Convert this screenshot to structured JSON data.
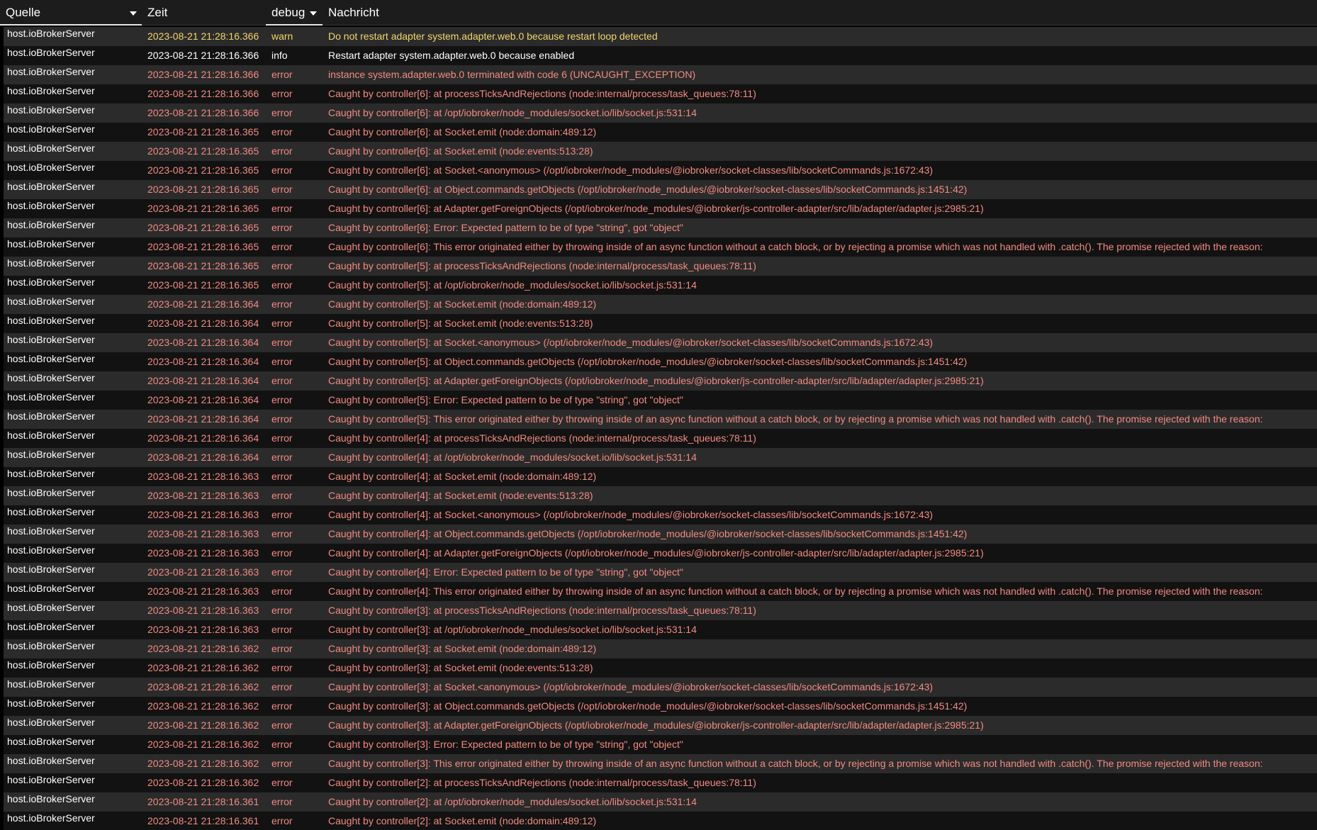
{
  "columns": {
    "source": "Quelle",
    "time": "Zeit",
    "severity": "debug",
    "message": "Nachricht"
  },
  "colors": {
    "error": "#f28b82",
    "warn": "#f3d56b",
    "info": "#ffffff"
  },
  "icons": {
    "source_filter": "chevron-down-icon",
    "severity_filter": "chevron-down-icon"
  },
  "rows": [
    {
      "source": "host.ioBrokerServer",
      "time": "2023-08-21 21:28:16.366",
      "severity": "warn",
      "message": "Do not restart adapter system.adapter.web.0 because restart loop detected"
    },
    {
      "source": "host.ioBrokerServer",
      "time": "2023-08-21 21:28:16.366",
      "severity": "info",
      "message": "Restart adapter system.adapter.web.0 because enabled"
    },
    {
      "source": "host.ioBrokerServer",
      "time": "2023-08-21 21:28:16.366",
      "severity": "error",
      "message": "instance system.adapter.web.0 terminated with code 6 (UNCAUGHT_EXCEPTION)"
    },
    {
      "source": "host.ioBrokerServer",
      "time": "2023-08-21 21:28:16.366",
      "severity": "error",
      "message": "Caught by controller[6]: at processTicksAndRejections (node:internal/process/task_queues:78:11)"
    },
    {
      "source": "host.ioBrokerServer",
      "time": "2023-08-21 21:28:16.366",
      "severity": "error",
      "message": "Caught by controller[6]: at /opt/iobroker/node_modules/socket.io/lib/socket.js:531:14"
    },
    {
      "source": "host.ioBrokerServer",
      "time": "2023-08-21 21:28:16.365",
      "severity": "error",
      "message": "Caught by controller[6]: at Socket.emit (node:domain:489:12)"
    },
    {
      "source": "host.ioBrokerServer",
      "time": "2023-08-21 21:28:16.365",
      "severity": "error",
      "message": "Caught by controller[6]: at Socket.emit (node:events:513:28)"
    },
    {
      "source": "host.ioBrokerServer",
      "time": "2023-08-21 21:28:16.365",
      "severity": "error",
      "message": "Caught by controller[6]: at Socket.<anonymous> (/opt/iobroker/node_modules/@iobroker/socket-classes/lib/socketCommands.js:1672:43)"
    },
    {
      "source": "host.ioBrokerServer",
      "time": "2023-08-21 21:28:16.365",
      "severity": "error",
      "message": "Caught by controller[6]: at Object.commands.getObjects (/opt/iobroker/node_modules/@iobroker/socket-classes/lib/socketCommands.js:1451:42)"
    },
    {
      "source": "host.ioBrokerServer",
      "time": "2023-08-21 21:28:16.365",
      "severity": "error",
      "message": "Caught by controller[6]: at Adapter.getForeignObjects (/opt/iobroker/node_modules/@iobroker/js-controller-adapter/src/lib/adapter/adapter.js:2985:21)"
    },
    {
      "source": "host.ioBrokerServer",
      "time": "2023-08-21 21:28:16.365",
      "severity": "error",
      "message": "Caught by controller[6]: Error: Expected pattern to be of type \"string\", got \"object\""
    },
    {
      "source": "host.ioBrokerServer",
      "time": "2023-08-21 21:28:16.365",
      "severity": "error",
      "message": "Caught by controller[6]: This error originated either by throwing inside of an async function without a catch block, or by rejecting a promise which was not handled with .catch(). The promise rejected with the reason:"
    },
    {
      "source": "host.ioBrokerServer",
      "time": "2023-08-21 21:28:16.365",
      "severity": "error",
      "message": "Caught by controller[5]: at processTicksAndRejections (node:internal/process/task_queues:78:11)"
    },
    {
      "source": "host.ioBrokerServer",
      "time": "2023-08-21 21:28:16.365",
      "severity": "error",
      "message": "Caught by controller[5]: at /opt/iobroker/node_modules/socket.io/lib/socket.js:531:14"
    },
    {
      "source": "host.ioBrokerServer",
      "time": "2023-08-21 21:28:16.364",
      "severity": "error",
      "message": "Caught by controller[5]: at Socket.emit (node:domain:489:12)"
    },
    {
      "source": "host.ioBrokerServer",
      "time": "2023-08-21 21:28:16.364",
      "severity": "error",
      "message": "Caught by controller[5]: at Socket.emit (node:events:513:28)"
    },
    {
      "source": "host.ioBrokerServer",
      "time": "2023-08-21 21:28:16.364",
      "severity": "error",
      "message": "Caught by controller[5]: at Socket.<anonymous> (/opt/iobroker/node_modules/@iobroker/socket-classes/lib/socketCommands.js:1672:43)"
    },
    {
      "source": "host.ioBrokerServer",
      "time": "2023-08-21 21:28:16.364",
      "severity": "error",
      "message": "Caught by controller[5]: at Object.commands.getObjects (/opt/iobroker/node_modules/@iobroker/socket-classes/lib/socketCommands.js:1451:42)"
    },
    {
      "source": "host.ioBrokerServer",
      "time": "2023-08-21 21:28:16.364",
      "severity": "error",
      "message": "Caught by controller[5]: at Adapter.getForeignObjects (/opt/iobroker/node_modules/@iobroker/js-controller-adapter/src/lib/adapter/adapter.js:2985:21)"
    },
    {
      "source": "host.ioBrokerServer",
      "time": "2023-08-21 21:28:16.364",
      "severity": "error",
      "message": "Caught by controller[5]: Error: Expected pattern to be of type \"string\", got \"object\""
    },
    {
      "source": "host.ioBrokerServer",
      "time": "2023-08-21 21:28:16.364",
      "severity": "error",
      "message": "Caught by controller[5]: This error originated either by throwing inside of an async function without a catch block, or by rejecting a promise which was not handled with .catch(). The promise rejected with the reason:"
    },
    {
      "source": "host.ioBrokerServer",
      "time": "2023-08-21 21:28:16.364",
      "severity": "error",
      "message": "Caught by controller[4]: at processTicksAndRejections (node:internal/process/task_queues:78:11)"
    },
    {
      "source": "host.ioBrokerServer",
      "time": "2023-08-21 21:28:16.364",
      "severity": "error",
      "message": "Caught by controller[4]: at /opt/iobroker/node_modules/socket.io/lib/socket.js:531:14"
    },
    {
      "source": "host.ioBrokerServer",
      "time": "2023-08-21 21:28:16.363",
      "severity": "error",
      "message": "Caught by controller[4]: at Socket.emit (node:domain:489:12)"
    },
    {
      "source": "host.ioBrokerServer",
      "time": "2023-08-21 21:28:16.363",
      "severity": "error",
      "message": "Caught by controller[4]: at Socket.emit (node:events:513:28)"
    },
    {
      "source": "host.ioBrokerServer",
      "time": "2023-08-21 21:28:16.363",
      "severity": "error",
      "message": "Caught by controller[4]: at Socket.<anonymous> (/opt/iobroker/node_modules/@iobroker/socket-classes/lib/socketCommands.js:1672:43)"
    },
    {
      "source": "host.ioBrokerServer",
      "time": "2023-08-21 21:28:16.363",
      "severity": "error",
      "message": "Caught by controller[4]: at Object.commands.getObjects (/opt/iobroker/node_modules/@iobroker/socket-classes/lib/socketCommands.js:1451:42)"
    },
    {
      "source": "host.ioBrokerServer",
      "time": "2023-08-21 21:28:16.363",
      "severity": "error",
      "message": "Caught by controller[4]: at Adapter.getForeignObjects (/opt/iobroker/node_modules/@iobroker/js-controller-adapter/src/lib/adapter/adapter.js:2985:21)"
    },
    {
      "source": "host.ioBrokerServer",
      "time": "2023-08-21 21:28:16.363",
      "severity": "error",
      "message": "Caught by controller[4]: Error: Expected pattern to be of type \"string\", got \"object\""
    },
    {
      "source": "host.ioBrokerServer",
      "time": "2023-08-21 21:28:16.363",
      "severity": "error",
      "message": "Caught by controller[4]: This error originated either by throwing inside of an async function without a catch block, or by rejecting a promise which was not handled with .catch(). The promise rejected with the reason:"
    },
    {
      "source": "host.ioBrokerServer",
      "time": "2023-08-21 21:28:16.363",
      "severity": "error",
      "message": "Caught by controller[3]: at processTicksAndRejections (node:internal/process/task_queues:78:11)"
    },
    {
      "source": "host.ioBrokerServer",
      "time": "2023-08-21 21:28:16.363",
      "severity": "error",
      "message": "Caught by controller[3]: at /opt/iobroker/node_modules/socket.io/lib/socket.js:531:14"
    },
    {
      "source": "host.ioBrokerServer",
      "time": "2023-08-21 21:28:16.362",
      "severity": "error",
      "message": "Caught by controller[3]: at Socket.emit (node:domain:489:12)"
    },
    {
      "source": "host.ioBrokerServer",
      "time": "2023-08-21 21:28:16.362",
      "severity": "error",
      "message": "Caught by controller[3]: at Socket.emit (node:events:513:28)"
    },
    {
      "source": "host.ioBrokerServer",
      "time": "2023-08-21 21:28:16.362",
      "severity": "error",
      "message": "Caught by controller[3]: at Socket.<anonymous> (/opt/iobroker/node_modules/@iobroker/socket-classes/lib/socketCommands.js:1672:43)"
    },
    {
      "source": "host.ioBrokerServer",
      "time": "2023-08-21 21:28:16.362",
      "severity": "error",
      "message": "Caught by controller[3]: at Object.commands.getObjects (/opt/iobroker/node_modules/@iobroker/socket-classes/lib/socketCommands.js:1451:42)"
    },
    {
      "source": "host.ioBrokerServer",
      "time": "2023-08-21 21:28:16.362",
      "severity": "error",
      "message": "Caught by controller[3]: at Adapter.getForeignObjects (/opt/iobroker/node_modules/@iobroker/js-controller-adapter/src/lib/adapter/adapter.js:2985:21)"
    },
    {
      "source": "host.ioBrokerServer",
      "time": "2023-08-21 21:28:16.362",
      "severity": "error",
      "message": "Caught by controller[3]: Error: Expected pattern to be of type \"string\", got \"object\""
    },
    {
      "source": "host.ioBrokerServer",
      "time": "2023-08-21 21:28:16.362",
      "severity": "error",
      "message": "Caught by controller[3]: This error originated either by throwing inside of an async function without a catch block, or by rejecting a promise which was not handled with .catch(). The promise rejected with the reason:"
    },
    {
      "source": "host.ioBrokerServer",
      "time": "2023-08-21 21:28:16.362",
      "severity": "error",
      "message": "Caught by controller[2]: at processTicksAndRejections (node:internal/process/task_queues:78:11)"
    },
    {
      "source": "host.ioBrokerServer",
      "time": "2023-08-21 21:28:16.361",
      "severity": "error",
      "message": "Caught by controller[2]: at /opt/iobroker/node_modules/socket.io/lib/socket.js:531:14"
    },
    {
      "source": "host.ioBrokerServer",
      "time": "2023-08-21 21:28:16.361",
      "severity": "error",
      "message": "Caught by controller[2]: at Socket.emit (node:domain:489:12)"
    }
  ]
}
